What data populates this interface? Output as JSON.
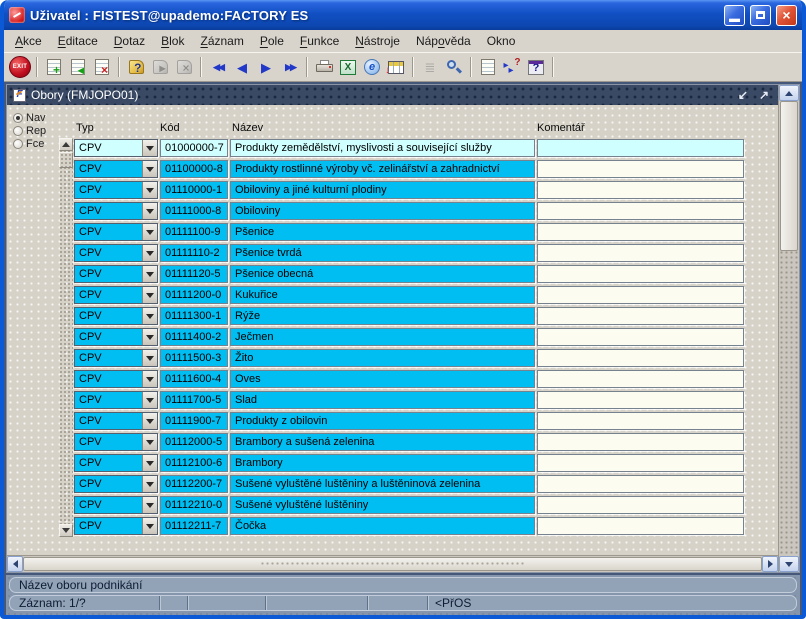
{
  "window": {
    "title": "Uživatel : FISTEST@upademo:FACTORY ES"
  },
  "menu": {
    "items": [
      {
        "name": "menu-akce",
        "label": "Akce",
        "accel": 0
      },
      {
        "name": "menu-editace",
        "label": "Editace",
        "accel": 0
      },
      {
        "name": "menu-dotaz",
        "label": "Dotaz",
        "accel": 0
      },
      {
        "name": "menu-blok",
        "label": "Blok",
        "accel": 0
      },
      {
        "name": "menu-zaznam",
        "label": "Záznam",
        "accel": 0
      },
      {
        "name": "menu-pole",
        "label": "Pole",
        "accel": 0
      },
      {
        "name": "menu-funkce",
        "label": "Funkce",
        "accel": 0
      },
      {
        "name": "menu-nastroje",
        "label": "Nástroje",
        "accel": 0
      },
      {
        "name": "menu-napoveda",
        "label": "Nápověda",
        "accel": 3
      },
      {
        "name": "menu-okno",
        "label": "Okno",
        "accel": -1
      }
    ]
  },
  "toolbar": {
    "buttons": [
      {
        "name": "exit-button",
        "kind": "exit",
        "label": "EXIT"
      },
      {
        "name": "sep"
      },
      {
        "name": "insert-record-button",
        "kind": "sheet",
        "overlay": "+",
        "overlay_color": "#18A018"
      },
      {
        "name": "copy-record-button",
        "kind": "sheet",
        "overlay": "◂",
        "overlay_color": "#18A018"
      },
      {
        "name": "delete-record-button",
        "kind": "sheet",
        "overlay": "×",
        "overlay_color": "#CC2020"
      },
      {
        "name": "sep"
      },
      {
        "name": "enter-query-button",
        "kind": "note",
        "overlay": "?",
        "overlay_color": "#25357A"
      },
      {
        "name": "execute-query-button",
        "kind": "note",
        "overlay": "▸",
        "overlay_color": "#555555",
        "disabled": true
      },
      {
        "name": "cancel-query-button",
        "kind": "note",
        "overlay": "×",
        "overlay_color": "#555555",
        "disabled": true
      },
      {
        "name": "sep"
      },
      {
        "name": "first-record-button",
        "kind": "glyph",
        "glyph": "◀◀",
        "double": true
      },
      {
        "name": "previous-record-button",
        "kind": "glyph",
        "glyph": "◀"
      },
      {
        "name": "next-record-button",
        "kind": "glyph",
        "glyph": "▶"
      },
      {
        "name": "last-record-button",
        "kind": "glyph",
        "glyph": "▶▶",
        "double": true
      },
      {
        "name": "sep"
      },
      {
        "name": "print-button",
        "kind": "printer"
      },
      {
        "name": "excel-export-button",
        "kind": "excel",
        "label": "X"
      },
      {
        "name": "web-browser-button",
        "kind": "web",
        "label": "e"
      },
      {
        "name": "table-export-button",
        "kind": "grid",
        "overlay": "↓"
      },
      {
        "name": "sep"
      },
      {
        "name": "list-values-button",
        "kind": "glyph",
        "glyph": "≣",
        "disabled": true
      },
      {
        "name": "zoom-button",
        "kind": "magnifier"
      },
      {
        "name": "sep"
      },
      {
        "name": "memo-button",
        "kind": "sheet"
      },
      {
        "name": "help-cursor-button",
        "kind": "helparrows",
        "label": "?"
      },
      {
        "name": "help-button",
        "kind": "help",
        "label": "?"
      },
      {
        "name": "sep"
      }
    ]
  },
  "inner_window": {
    "title": "Obory (FMJOPO01)",
    "restore_glyph": "↙",
    "maximize_glyph": "↗"
  },
  "sidebar": {
    "radios": [
      {
        "label": "Nav",
        "selected": true
      },
      {
        "label": "Rep",
        "selected": false
      },
      {
        "label": "Fce",
        "selected": false
      }
    ]
  },
  "table": {
    "columns": [
      "Typ",
      "Kód",
      "Název",
      "Komentář"
    ],
    "rows": [
      {
        "typ": "CPV",
        "kod": "01000000-7",
        "nazev": "Produkty zemědělství, myslivosti a související služby",
        "komentar": "",
        "current": true
      },
      {
        "typ": "CPV",
        "kod": "01100000-8",
        "nazev": "Produkty rostlinné výroby vč. zelinářství a zahradnictví",
        "komentar": ""
      },
      {
        "typ": "CPV",
        "kod": "01110000-1",
        "nazev": "Obiloviny a jiné kulturní plodiny",
        "komentar": ""
      },
      {
        "typ": "CPV",
        "kod": "01111000-8",
        "nazev": "Obiloviny",
        "komentar": ""
      },
      {
        "typ": "CPV",
        "kod": "01111100-9",
        "nazev": "Pšenice",
        "komentar": ""
      },
      {
        "typ": "CPV",
        "kod": "01111110-2",
        "nazev": "Pšenice tvrdá",
        "komentar": ""
      },
      {
        "typ": "CPV",
        "kod": "01111120-5",
        "nazev": "Pšenice obecná",
        "komentar": ""
      },
      {
        "typ": "CPV",
        "kod": "01111200-0",
        "nazev": "Kukuřice",
        "komentar": ""
      },
      {
        "typ": "CPV",
        "kod": "01111300-1",
        "nazev": "Rýže",
        "komentar": ""
      },
      {
        "typ": "CPV",
        "kod": "01111400-2",
        "nazev": "Ječmen",
        "komentar": ""
      },
      {
        "typ": "CPV",
        "kod": "01111500-3",
        "nazev": "Žito",
        "komentar": ""
      },
      {
        "typ": "CPV",
        "kod": "01111600-4",
        "nazev": "Oves",
        "komentar": ""
      },
      {
        "typ": "CPV",
        "kod": "01111700-5",
        "nazev": "Slad",
        "komentar": ""
      },
      {
        "typ": "CPV",
        "kod": "01111900-7",
        "nazev": "Produkty z obilovin",
        "komentar": ""
      },
      {
        "typ": "CPV",
        "kod": "01112000-5",
        "nazev": "Brambory a sušená zelenina",
        "komentar": ""
      },
      {
        "typ": "CPV",
        "kod": "01112100-6",
        "nazev": "Brambory",
        "komentar": ""
      },
      {
        "typ": "CPV",
        "kod": "01112200-7",
        "nazev": "Sušené vyluštěné luštěniny a luštěninová zelenina",
        "komentar": ""
      },
      {
        "typ": "CPV",
        "kod": "01112210-0",
        "nazev": "Sušené vyluštěné luštěniny",
        "komentar": ""
      },
      {
        "typ": "CPV",
        "kod": "01112211-7",
        "nazev": "Čočka",
        "komentar": ""
      }
    ]
  },
  "statusbar": {
    "message": "Název oboru podnikání",
    "segments": [
      {
        "text": "Záznam: 1/?",
        "width": 140
      },
      {
        "text": "",
        "width": 28
      },
      {
        "text": "",
        "width": 78
      },
      {
        "text": "",
        "width": 102
      },
      {
        "text": "",
        "width": 60
      },
      {
        "text": "<PřOS",
        "width": 0
      }
    ]
  },
  "colors": {
    "row_cyan": "#00BEF2",
    "row_current": "#CFFFFF",
    "komentar_bg": "#FCFCF0",
    "titlebar_blue": "#1150C4",
    "inner_titlebar": "#3A4A64",
    "canvas": "#D6D2C8",
    "status_bg": "#8495AC"
  }
}
